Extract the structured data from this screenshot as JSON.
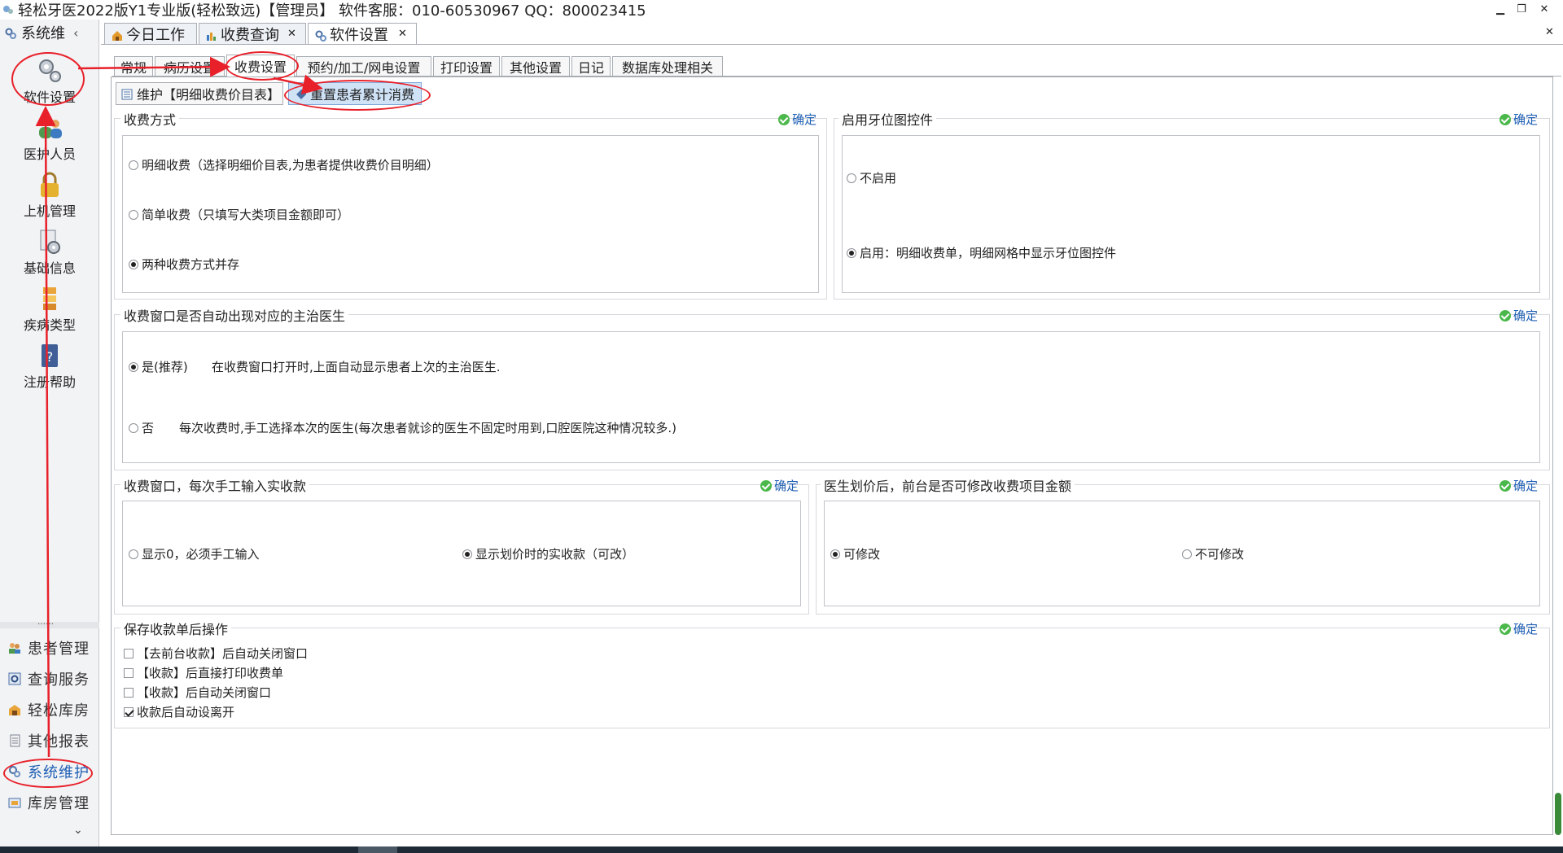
{
  "window": {
    "title": "轻松牙医2022版Y1专业版(轻松致远)【管理员】      软件客服：010-60530967 QQ：800023415"
  },
  "sidebar": {
    "header": "系统维",
    "big_items": [
      {
        "label": "软件设置",
        "icon": "gears-icon"
      },
      {
        "label": "医护人员",
        "icon": "people-icon"
      },
      {
        "label": "上机管理",
        "icon": "lock-icon"
      },
      {
        "label": "基础信息",
        "icon": "gear-doc-icon"
      },
      {
        "label": "疾病类型",
        "icon": "stack-icon"
      },
      {
        "label": "注册帮助",
        "icon": "help-book-icon"
      }
    ],
    "dots": "……",
    "modules": [
      {
        "label": "患者管理",
        "icon": "patients-icon"
      },
      {
        "label": "查询服务",
        "icon": "query-icon"
      },
      {
        "label": "轻松库房",
        "icon": "warehouse-icon"
      },
      {
        "label": "其他报表",
        "icon": "report-icon"
      },
      {
        "label": "系统维护",
        "icon": "system-icon",
        "active": true
      },
      {
        "label": "库房管理",
        "icon": "storage-icon"
      }
    ]
  },
  "tabs": [
    {
      "label": "今日工作",
      "closable": false
    },
    {
      "label": "收费查询",
      "closable": true
    },
    {
      "label": "软件设置",
      "closable": true,
      "active": true
    }
  ],
  "subtabs": [
    "常规",
    "病历设置",
    "收费设置",
    "预约/加工/网电设置",
    "打印设置",
    "其他设置",
    "日记",
    "数据库处理相关"
  ],
  "toolbar": {
    "maintain_label": "维护【明细收费价目表】",
    "reset_label": "重置患者累计消费"
  },
  "ok_label": "确定",
  "groups": {
    "payment_method": {
      "title": "收费方式",
      "options": [
        "明细收费（选择明细价目表,为患者提供收费价目明细）",
        "简单收费（只填写大类项目金额即可）",
        "两种收费方式并存"
      ],
      "selected": 2
    },
    "tooth_chart": {
      "title": "启用牙位图控件",
      "options": [
        "不启用",
        "启用：明细收费单，明细网格中显示牙位图控件"
      ],
      "selected": 1
    },
    "doctor_auto": {
      "title": "收费窗口是否自动出现对应的主治医生",
      "options": [
        {
          "label": "是(推荐)",
          "desc": "在收费窗口打开时,上面自动显示患者上次的主治医生."
        },
        {
          "label": "否",
          "desc": "每次收费时,手工选择本次的医生(每次患者就诊的医生不固定时用到,口腔医院这种情况较多.)"
        }
      ],
      "selected": 0
    },
    "manual_amount": {
      "title": "收费窗口，每次手工输入实收款",
      "options": [
        "显示0，必须手工输入",
        "显示划价时的实收款（可改）"
      ],
      "selected": 1
    },
    "modify_amount": {
      "title": "医生划价后，前台是否可修改收费项目金额",
      "options": [
        "可修改",
        "不可修改"
      ],
      "selected": 0
    },
    "after_save": {
      "title": "保存收款单后操作",
      "checks": [
        {
          "label": "【去前台收款】后自动关闭窗口",
          "checked": false
        },
        {
          "label": "【收款】后直接打印收费单",
          "checked": false
        },
        {
          "label": "【收款】后自动关闭窗口",
          "checked": false
        },
        {
          "label": "收款后自动设离开",
          "checked": true
        }
      ]
    }
  },
  "colors": {
    "annotation_red": "#e8202a",
    "ok_blue": "#1f5fb4",
    "ok_green": "#4bb84b"
  }
}
